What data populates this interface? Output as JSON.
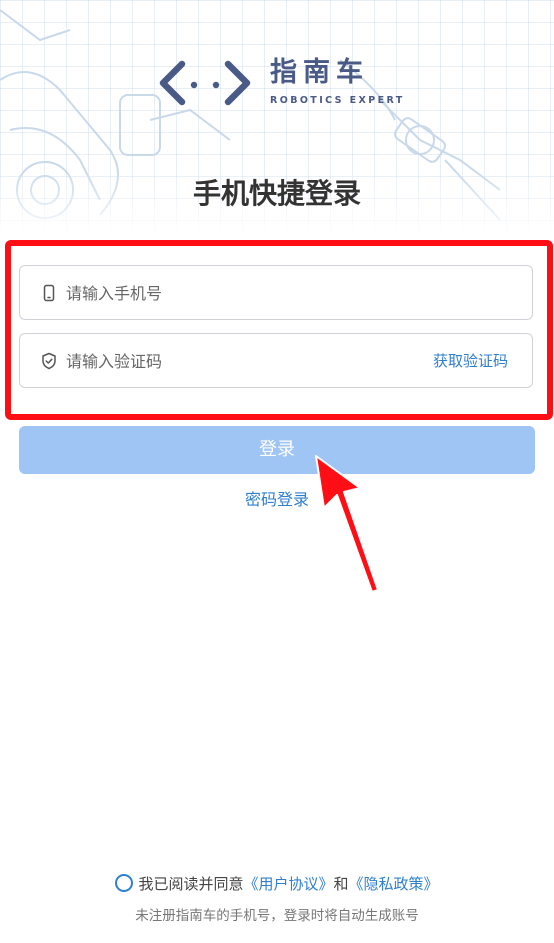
{
  "brand": {
    "name_cn": "指南车",
    "name_en": "ROBOTICS EXPERT"
  },
  "page": {
    "title": "手机快捷登录"
  },
  "form": {
    "phone_placeholder": "请输入手机号",
    "code_placeholder": "请输入验证码",
    "get_code_label": "获取验证码",
    "login_label": "登录",
    "password_login_label": "密码登录"
  },
  "agreement": {
    "prefix": "我已阅读并同意",
    "user_agreement": "《用户协议》",
    "and": "和",
    "privacy_policy": "《隐私政策》",
    "notice": "未注册指南车的手机号，登录时将自动生成账号"
  },
  "colors": {
    "accent": "#2f7fd0",
    "login_button": "#9fc5f5",
    "highlight": "#ff0e16",
    "brand": "#4a5a86"
  },
  "icons": {
    "phone": "phone-icon",
    "shield": "shield-check-icon",
    "logo": "code-brackets-logo-icon",
    "annotation_arrow": "arrow-pointer-icon"
  }
}
